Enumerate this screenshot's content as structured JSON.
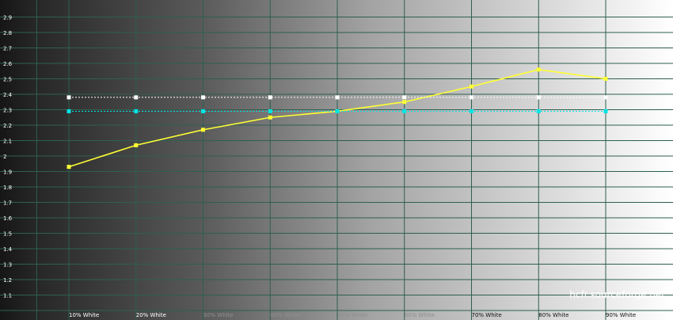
{
  "chart_data": {
    "type": "line",
    "categories": [
      "10% White",
      "20% White",
      "30% White",
      "40% White",
      "50% White",
      "60% White",
      "70% White",
      "80% White",
      "90% White"
    ],
    "y_ticks": [
      "1.1",
      "1.2",
      "1.3",
      "1.4",
      "1.5",
      "1.6",
      "1.7",
      "1.8",
      "1.9",
      "2",
      "2.1",
      "2.2",
      "2.3",
      "2.4",
      "2.5",
      "2.6",
      "2.7",
      "2.8",
      "2.9"
    ],
    "ylim": [
      1.0,
      3.0
    ],
    "grid": true,
    "background": "black-to-white gradient",
    "series": [
      {
        "values": [
          1.93,
          2.07,
          2.17,
          2.25,
          2.29,
          2.35,
          2.45,
          2.56,
          2.5
        ],
        "color": "#ffff33",
        "style": "solid"
      },
      {
        "values": [
          2.38,
          2.38,
          2.38,
          2.38,
          2.38,
          2.38,
          2.38,
          2.38,
          2.38
        ],
        "color": "#ffffff",
        "style": "dotted"
      },
      {
        "values": [
          2.29,
          2.29,
          2.29,
          2.29,
          2.29,
          2.29,
          2.29,
          2.29,
          2.29
        ],
        "color": "#00e5e5",
        "style": "dotted"
      }
    ]
  },
  "watermark": "hcfr.sourceforge.net"
}
